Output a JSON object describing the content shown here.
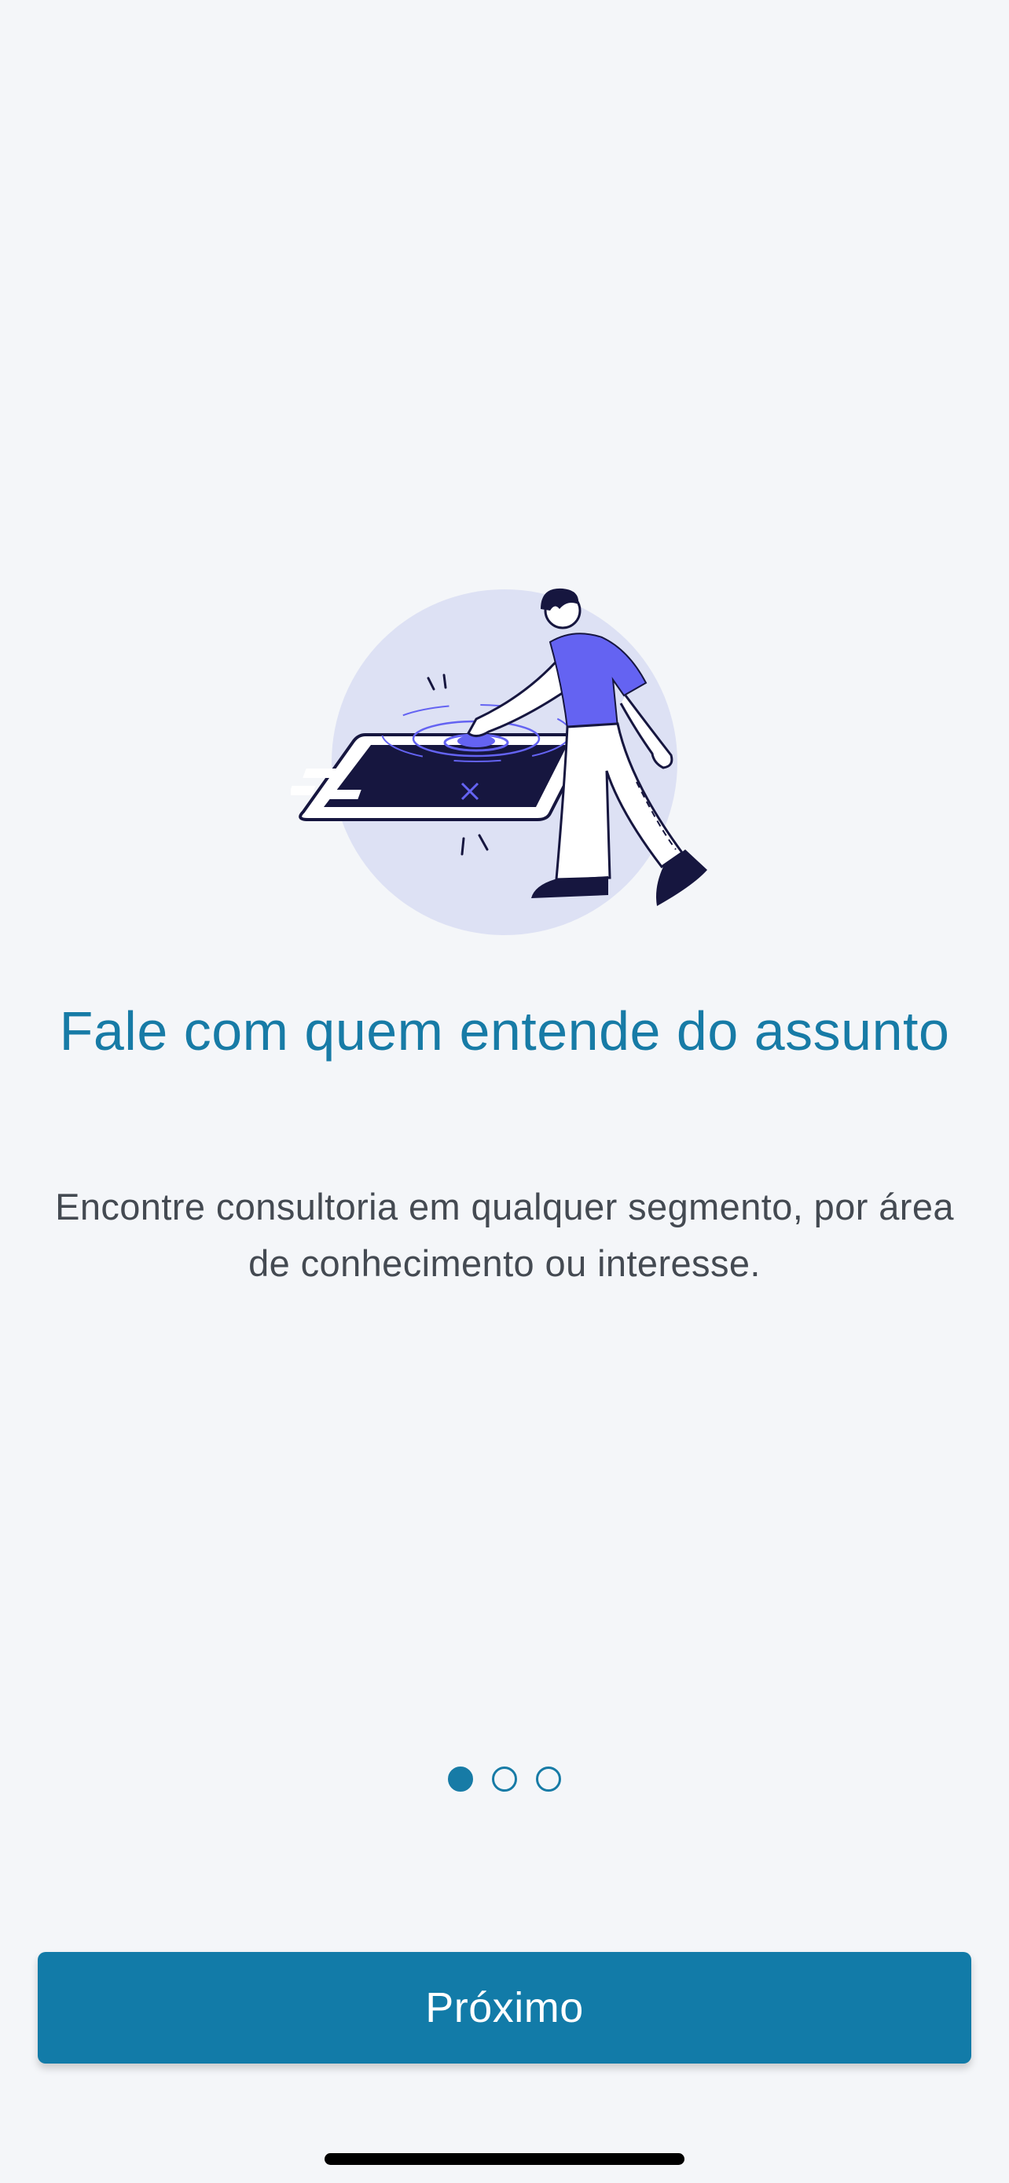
{
  "onboarding": {
    "illustration_icon": "person-pressing-tablet-icon",
    "title": "Fale com quem entende do assunto",
    "description": "Encontre consultoria em qualquer segmento, por área de conhecimento ou interesse.",
    "pages": {
      "total": 3,
      "current": 1
    },
    "next_label": "Próximo"
  },
  "colors": {
    "background": "#f4f6f9",
    "accent": "#177ba6",
    "illustration_purple": "#6463f2",
    "illustration_navy": "#16163f",
    "illustration_circle": "#dde1f4"
  }
}
